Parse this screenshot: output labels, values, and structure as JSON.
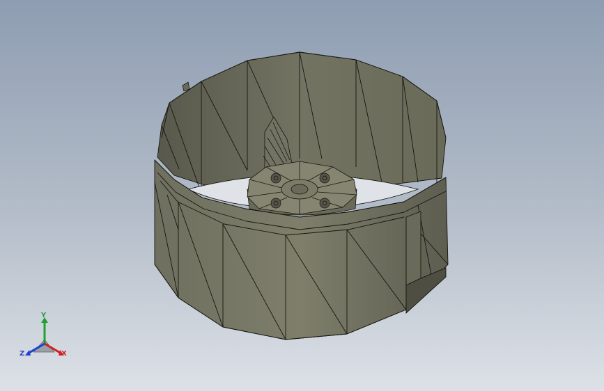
{
  "viewport": {
    "background_top": "#8e9db2",
    "background_bottom": "#dde1e7"
  },
  "model": {
    "shade_colors": [
      "#5e5e50",
      "#6c6c5c",
      "#7a7a68",
      "#888873"
    ],
    "edge_color": "#15150f"
  },
  "triad": {
    "x_label": "X",
    "y_label": "Y",
    "z_label": "Z",
    "x_color": "#d02020",
    "y_color": "#20a030",
    "z_color": "#2040d0"
  }
}
